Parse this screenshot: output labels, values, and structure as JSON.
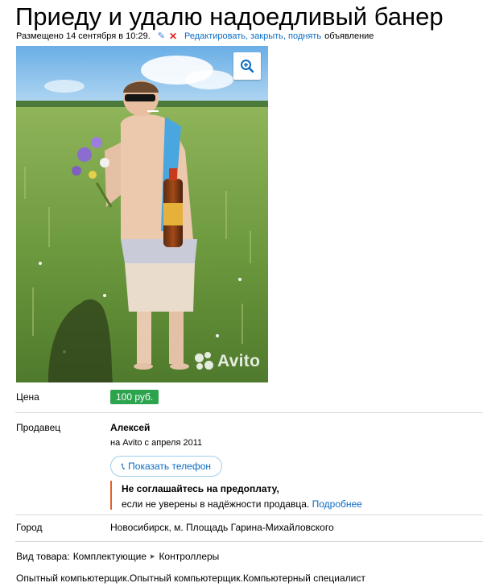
{
  "listing": {
    "title": "Приеду и удалю надоедливый банер",
    "posted": "Размещено 14 сентября в 10:29.",
    "edit_link": "Редактировать, закрыть, поднять",
    "edit_tail": "объявление",
    "photo_watermark": "Avito"
  },
  "price": {
    "label": "Цена",
    "value": "100 руб."
  },
  "seller": {
    "label": "Продавец",
    "name": "Алексей",
    "since": "на Avito с апреля 2011",
    "phone_button": "Показать телефон",
    "warning_title": "Не соглашайтесь на предоплату,",
    "warning_text": "если не уверены в надёжности продавца.",
    "warning_link": "Подробнее"
  },
  "city": {
    "label": "Город",
    "value": "Новосибирск, м. Площадь Гарина-Михайловского"
  },
  "category": {
    "prefix": "Вид товара:",
    "level1": "Комплектующие",
    "level2": "Контроллеры"
  },
  "description": "Опытный компьютерщик.Опытный компьютерщик.Компьютерный специалист",
  "icons": {
    "edit": "pencil-icon",
    "close": "close-icon",
    "zoom": "zoom-in-icon",
    "phone": "phone-icon",
    "breadcrumb_separator": "triangle-right-icon"
  },
  "colors": {
    "link": "#0a6bc4",
    "price_badge": "#2ca44e",
    "warning_accent": "#e8602a",
    "close_icon": "#e02020"
  }
}
